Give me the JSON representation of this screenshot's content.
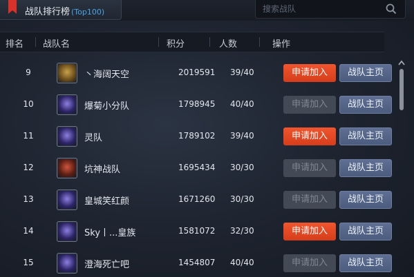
{
  "title": {
    "main": "战队排行榜",
    "sub": "(Top100)"
  },
  "search": {
    "placeholder": "搜索战队"
  },
  "columns": {
    "rank": "排名",
    "name": "战队名",
    "score": "积分",
    "members": "人数",
    "action": "操作"
  },
  "buttons": {
    "apply": "申请加入",
    "home": "战队主页"
  },
  "colors": {
    "apply_active": "#e84a24",
    "apply_disabled": "#444a55",
    "home": "#56668a",
    "sub_title": "#4aa3e6"
  },
  "rows": [
    {
      "rank": "9",
      "name": "丶海阔天空",
      "score": "2019591",
      "members": "39/40",
      "apply_enabled": true,
      "avatar": "emblem-gold"
    },
    {
      "rank": "10",
      "name": "爆菊小分队",
      "score": "1798945",
      "members": "40/40",
      "apply_enabled": false,
      "avatar": "emblem-purple"
    },
    {
      "rank": "11",
      "name": "灵队",
      "score": "1789102",
      "members": "39/40",
      "apply_enabled": true,
      "avatar": "emblem-purple"
    },
    {
      "rank": "12",
      "name": "坑神战队",
      "score": "1695434",
      "members": "30/30",
      "apply_enabled": false,
      "avatar": "emblem-red"
    },
    {
      "rank": "13",
      "name": "皇城笑红颜",
      "score": "1671260",
      "members": "30/30",
      "apply_enabled": false,
      "avatar": "emblem-purple"
    },
    {
      "rank": "14",
      "name": "Sky丨...皇族",
      "score": "1581072",
      "members": "32/30",
      "apply_enabled": true,
      "avatar": "emblem-purple"
    },
    {
      "rank": "15",
      "name": "澄海死亡吧",
      "score": "1454807",
      "members": "40/40",
      "apply_enabled": false,
      "avatar": "emblem-purple"
    }
  ]
}
